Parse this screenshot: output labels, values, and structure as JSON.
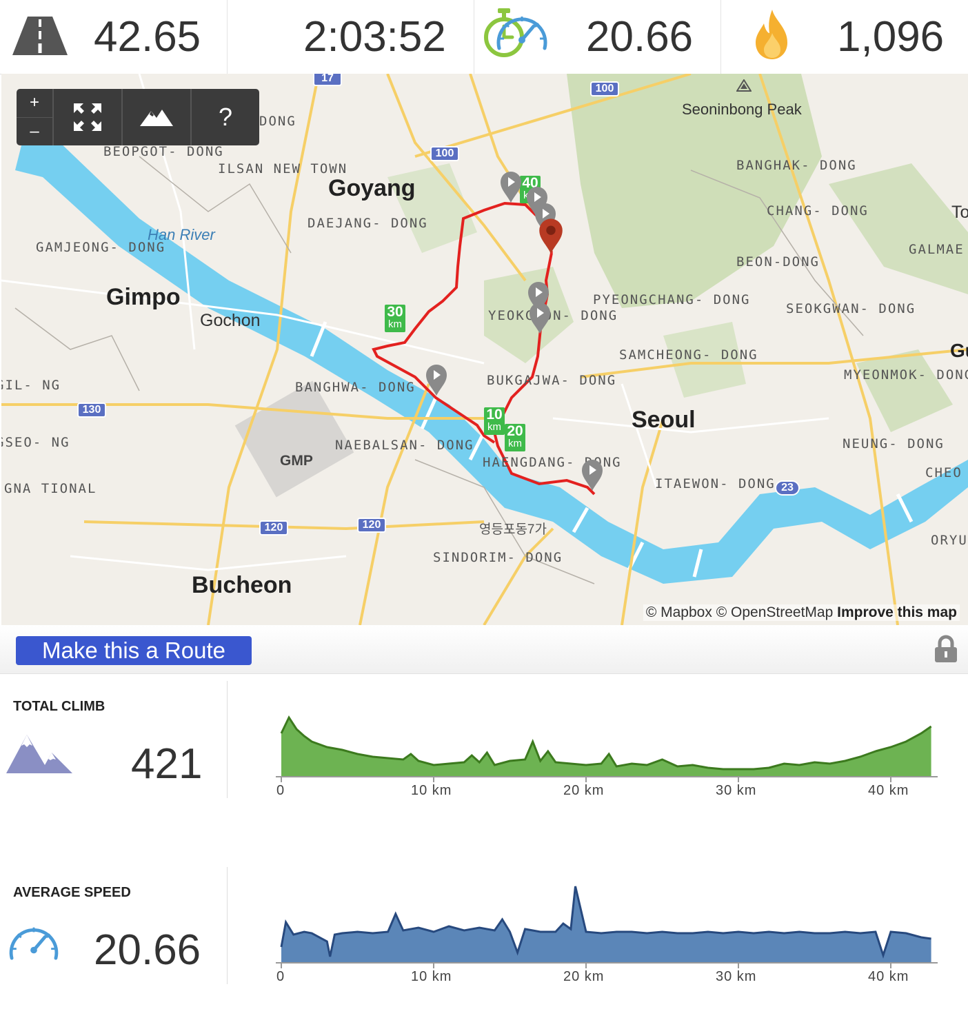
{
  "stats": {
    "distance": {
      "value": "42.65",
      "icon": "road-icon"
    },
    "duration": {
      "value": "2:03:52",
      "icon": "stopwatch-icon"
    },
    "speed": {
      "value": "20.66",
      "icon": "speedometer-icon"
    },
    "calories": {
      "value": "1,096",
      "icon": "flame-icon"
    }
  },
  "map": {
    "controls": {
      "zoom_in": "+",
      "zoom_out": "–",
      "help": "?"
    },
    "labels": {
      "cities": [
        "Goyang",
        "Gimpo",
        "Seoul",
        "Bucheon"
      ],
      "towns": [
        "Gochon",
        "Seoninbong Peak",
        "Han River",
        "GMP",
        "영등포동7가"
      ],
      "districts": [
        "BEOPGOT-\nDONG",
        "ILSAN NEW\nTOWN",
        "DAEJANG-\nDONG",
        "GAMJEONG-\nDONG",
        "BANGHWA-\nDONG",
        "NAEBALSAN-\nDONG",
        "HAENGDANG-\nDONG",
        "SINDORIM-\nDONG",
        "YEOKCHON-\nDONG",
        "BUKGAJWA-\nDONG",
        "PYEONGCHANG-\nDONG",
        "SAMCHEONG-\nDONG",
        "BANGHAK-\nDONG",
        "CHANG-\nDONG",
        "BEON-DONG",
        "SEOKGWAN-\nDONG",
        "MYEONMOK-\nDONG",
        "ITAEWON-\nDONG",
        "NEUNG-\nDONG",
        "GALMAE\nDONG",
        "CHEO\nDO",
        "ORYU\nDON"
      ],
      "left_edge": [
        "GIL-\nNG",
        "GSEO-\nNG",
        "GNA\nTIONAL"
      ],
      "partial": [
        "DONG",
        "To",
        "Gu"
      ]
    },
    "roads": [
      "17",
      "100",
      "100",
      "130",
      "120",
      "120",
      "23"
    ],
    "km_markers": [
      {
        "km": "10",
        "unit": "km"
      },
      {
        "km": "20",
        "unit": "km"
      },
      {
        "km": "30",
        "unit": "km"
      },
      {
        "km": "40",
        "unit": "km"
      }
    ],
    "attribution": {
      "mapbox": "© Mapbox",
      "osm": "© OpenStreetMap",
      "improve": "Improve this map"
    },
    "colors": {
      "route": "#e3211f",
      "water": "#75cff0",
      "green": "#c9dcb1"
    }
  },
  "actions": {
    "make_route": "Make this a Route"
  },
  "elevation": {
    "label": "TOTAL CLIMB",
    "value": "421",
    "icon": "mountains-icon",
    "ticks": [
      "0",
      "10 km",
      "20 km",
      "30 km",
      "40 km"
    ],
    "color": "#6db352",
    "line_color": "#3c7a1e",
    "x_km": [
      0,
      0.5,
      1,
      1.5,
      2,
      3,
      4,
      5,
      6,
      7,
      8,
      8.5,
      9,
      10,
      11,
      12,
      12.5,
      13,
      13.5,
      14,
      15,
      16,
      16.5,
      17,
      17.5,
      18,
      19,
      20,
      21,
      21.5,
      22,
      23,
      24,
      25,
      26,
      27,
      28,
      29,
      30,
      31,
      32,
      33,
      34,
      35,
      36,
      37,
      38,
      39,
      40,
      41,
      42,
      42.65
    ],
    "y": [
      62,
      85,
      68,
      58,
      50,
      42,
      38,
      32,
      28,
      26,
      24,
      32,
      22,
      16,
      18,
      20,
      30,
      20,
      34,
      16,
      22,
      24,
      50,
      22,
      36,
      20,
      18,
      16,
      18,
      32,
      14,
      18,
      16,
      24,
      14,
      16,
      12,
      10,
      10,
      10,
      12,
      18,
      16,
      20,
      18,
      22,
      28,
      36,
      42,
      50,
      62,
      72
    ]
  },
  "speed_chart": {
    "label": "AVERAGE SPEED",
    "value": "20.66",
    "icon": "speedometer-icon",
    "ticks": [
      "0",
      "10 km",
      "20 km",
      "30 km",
      "40 km"
    ],
    "color": "#5b86b8",
    "line_color": "#27497e",
    "x_km": [
      0,
      0.3,
      0.8,
      1.5,
      2,
      3,
      3.2,
      3.5,
      4,
      5,
      6,
      7,
      7.5,
      8,
      9,
      10,
      11,
      12,
      13,
      14,
      14.5,
      15,
      15.5,
      16,
      17,
      18,
      18.5,
      19,
      19.3,
      20,
      21,
      22,
      23,
      24,
      25,
      26,
      27,
      28,
      29,
      30,
      31,
      32,
      33,
      34,
      35,
      36,
      37,
      38,
      39,
      39.5,
      40,
      41,
      42,
      42.65
    ],
    "y": [
      22,
      58,
      40,
      44,
      42,
      30,
      8,
      40,
      42,
      44,
      42,
      44,
      70,
      46,
      50,
      44,
      52,
      46,
      50,
      46,
      62,
      44,
      14,
      48,
      44,
      44,
      56,
      48,
      110,
      44,
      42,
      44,
      44,
      42,
      44,
      42,
      42,
      44,
      42,
      44,
      42,
      44,
      42,
      44,
      42,
      42,
      44,
      42,
      44,
      10,
      44,
      42,
      36,
      34
    ]
  }
}
